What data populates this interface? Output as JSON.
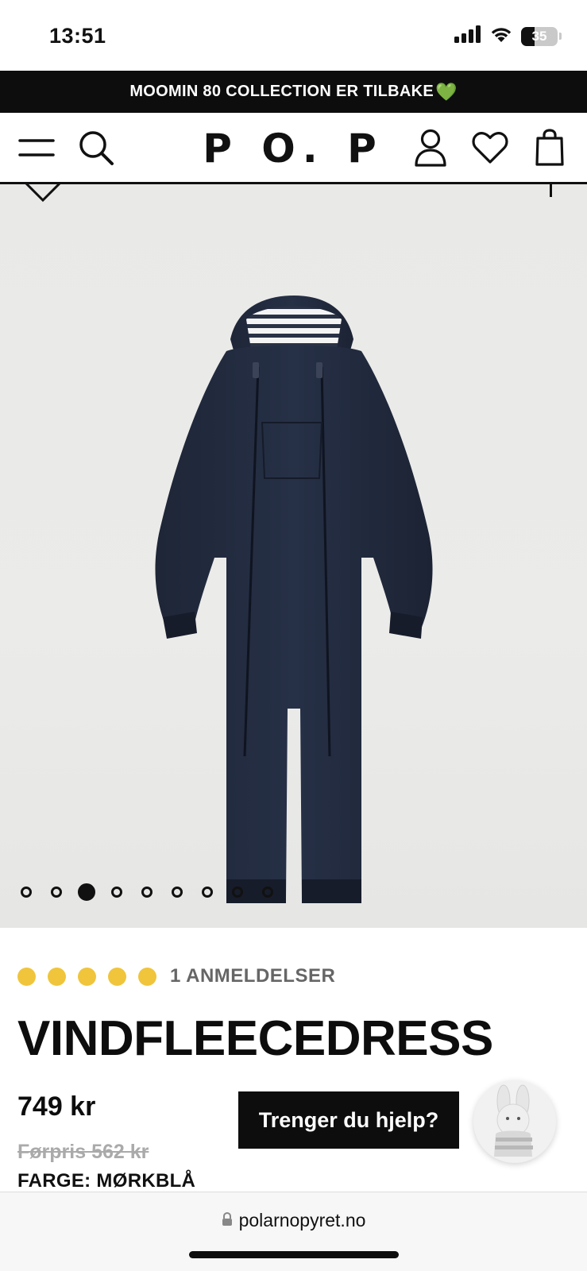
{
  "status_bar": {
    "time": "13:51",
    "battery": "35",
    "icons": [
      "signal-icon",
      "wifi-icon",
      "battery-icon"
    ]
  },
  "promo": {
    "text": "MOOMIN 80 COLLECTION ER TILBAKE",
    "emoji": "💚"
  },
  "header": {
    "logo": "P O. P",
    "icons": [
      "menu-icon",
      "search-icon",
      "account-icon",
      "heart-icon",
      "bag-icon"
    ]
  },
  "gallery": {
    "image_count": 9,
    "active_index": 2
  },
  "product": {
    "rating_dots": 5,
    "rating_color": "#f0c53c",
    "reviews": "1 ANMELDELSER",
    "title": "VINDFLEECEDRESS",
    "price": "749 kr",
    "old_price": "Førpris 562 kr",
    "color": "FARGE: MØRKBLÅ"
  },
  "help": {
    "label": "Trenger du hjelp?"
  },
  "browser": {
    "url": "polarnopyret.no"
  }
}
